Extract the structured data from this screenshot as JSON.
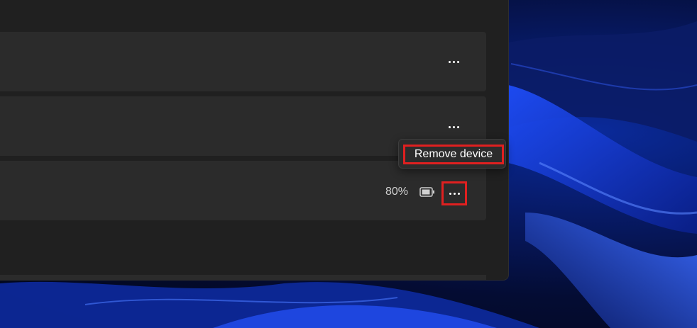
{
  "devices": [
    {
      "name": "",
      "menu_icon": "more-horizontal-icon"
    },
    {
      "name": "",
      "menu_icon": "more-horizontal-icon"
    },
    {
      "name": "",
      "battery": "80%",
      "battery_icon": "battery-icon",
      "menu_icon": "more-horizontal-icon"
    }
  ],
  "tooltip": {
    "label": "Remove device"
  },
  "colors": {
    "panel": "#202020",
    "card": "#2b2b2b",
    "highlight": "#e02020",
    "wallpaper": "#0a2a9a"
  }
}
